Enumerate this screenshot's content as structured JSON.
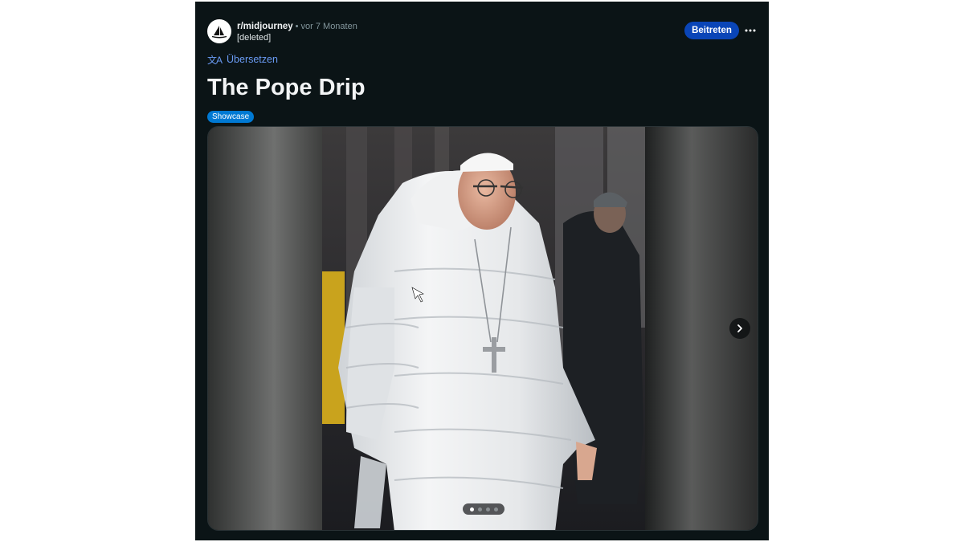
{
  "post": {
    "subreddit": "r/midjourney",
    "separator": "•",
    "time_ago": "vor 7 Monaten",
    "author": "[deleted]",
    "join_label": "Beitreten",
    "more_label": "•••",
    "translate_icon": "文A",
    "translate_label": "Übersetzen",
    "title": "The Pope Drip",
    "flair": "Showcase"
  },
  "gallery": {
    "image_count": 4,
    "active_index": 0,
    "next_icon": "chevron-right-icon"
  },
  "colors": {
    "background": "#0b1416",
    "join_button": "#0a45b7",
    "translate_link": "#6a9bf4",
    "flair": "#0079d3"
  }
}
